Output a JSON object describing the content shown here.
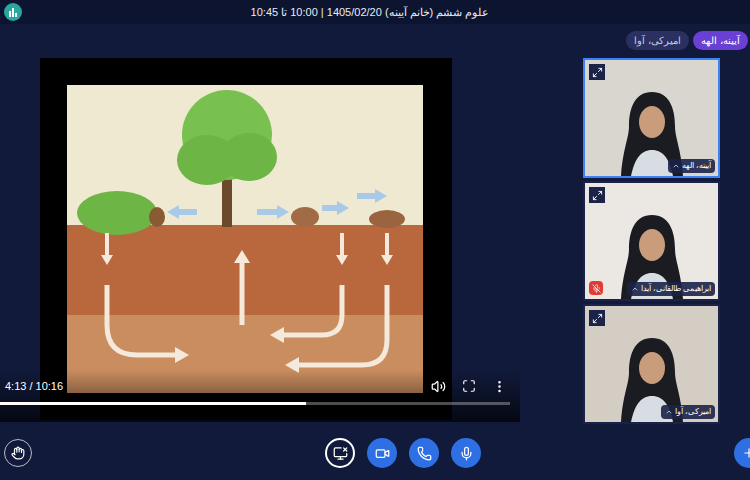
{
  "app": {
    "title": "علوم ششم (خانم آیینه) 1405/02/20 | 10:00 تا 10:45"
  },
  "speakers": [
    {
      "name": "آیینه، الهه",
      "selected": true
    },
    {
      "name": "امیرکی، آوا",
      "selected": false
    }
  ],
  "video": {
    "time": "4:13 / 10:16",
    "level": 0.6
  },
  "participants": [
    {
      "name": "آیینه، الهه",
      "speaking": true,
      "muted": false
    },
    {
      "name": "ابراهیمی طالقانی، آیدا",
      "speaking": false,
      "muted": true
    },
    {
      "name": "امیرکی، آوا",
      "speaking": false,
      "muted": false
    }
  ],
  "toolbar": [
    {
      "kind": "screen",
      "active": false
    },
    {
      "kind": "camera",
      "active": true
    },
    {
      "kind": "phone",
      "active": true
    },
    {
      "kind": "mic",
      "active": true
    }
  ]
}
